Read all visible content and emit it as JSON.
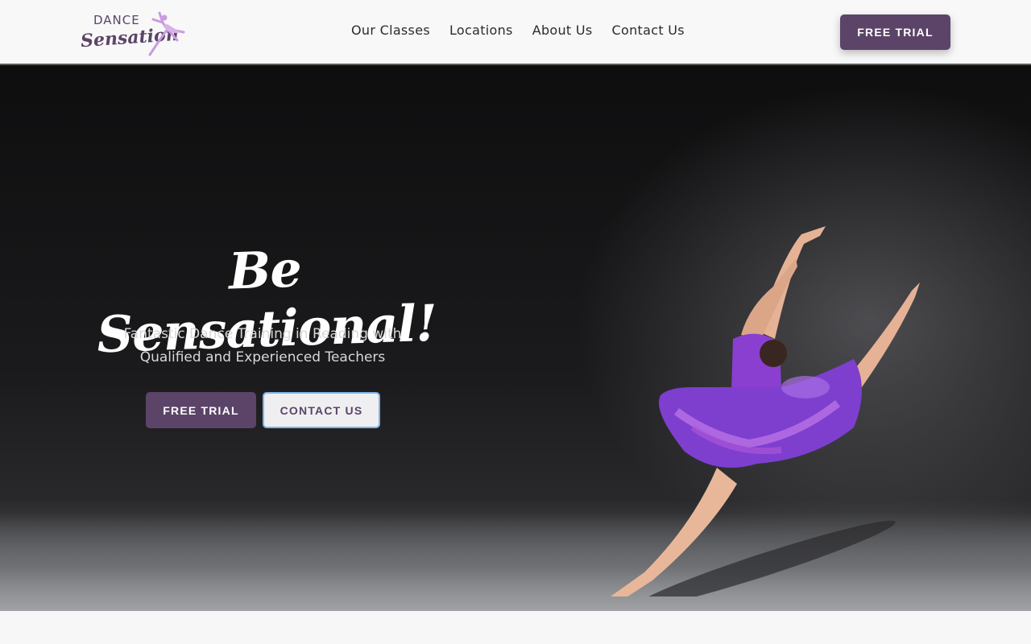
{
  "header": {
    "logo": {
      "line1": "DANCE",
      "line2": "Sensation"
    },
    "nav": [
      "Our Classes",
      "Locations",
      "About Us",
      "Contact Us"
    ],
    "cta": "FREE TRIAL"
  },
  "hero": {
    "title": "Be Sensational!",
    "subtitle_line1": "Fantastic Dance Training in Reading with",
    "subtitle_line2": "Qualified and Experienced Teachers",
    "primary_button": "FREE TRIAL",
    "secondary_button": "CONTACT US"
  },
  "colors": {
    "brand": "#5b4468",
    "focus_ring": "#7fb3e6",
    "dress": "#8a3fd1"
  },
  "icons": {
    "logo_figure": "dancer-icon",
    "hero_image": "leaping-dancer-photo"
  }
}
